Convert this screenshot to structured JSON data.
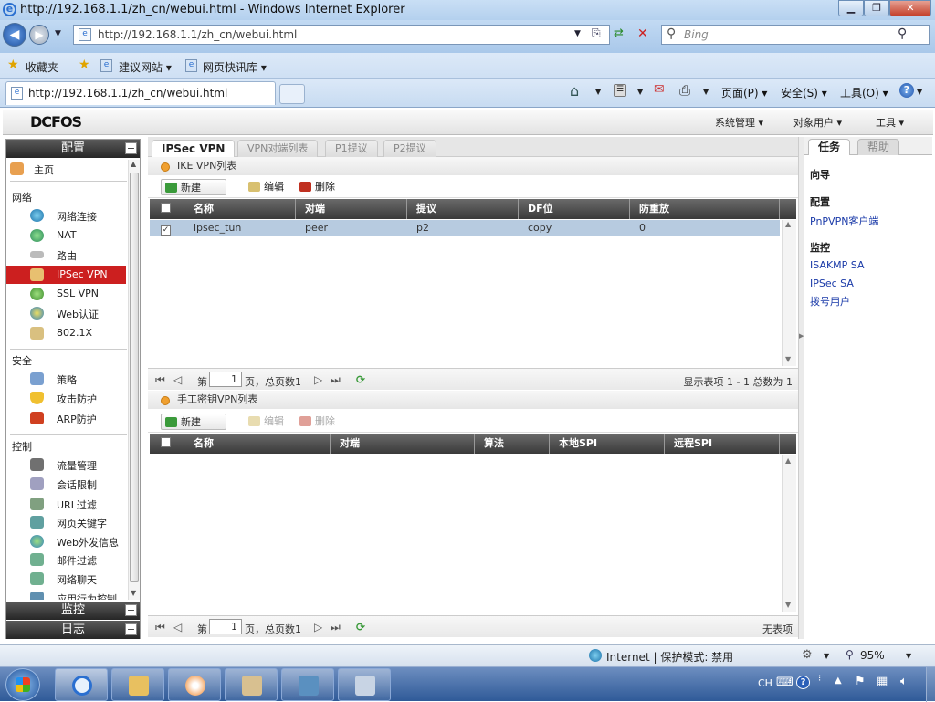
{
  "browser": {
    "window_title": "http://192.168.1.1/zh_cn/webui.html - Windows Internet Explorer",
    "address": "http://192.168.1.1/zh_cn/webui.html",
    "search_placeholder": "Bing",
    "favorites_label": "收藏夹",
    "fav_links": [
      "建议网站 ▾",
      "网页快讯库 ▾"
    ],
    "tab_title": "http://192.168.1.1/zh_cn/webui.html",
    "commands": [
      "页面(P) ▾",
      "安全(S) ▾",
      "工具(O) ▾"
    ]
  },
  "app": {
    "logo": "DCFOS",
    "top_menu": [
      "系统管理 ▾",
      "对象用户 ▾",
      "工具 ▾"
    ]
  },
  "sidebar": {
    "config_header": "配置",
    "monitor_header": "监控",
    "log_header": "日志",
    "home": "主页",
    "groups": {
      "network": "网络",
      "security": "安全",
      "control": "控制"
    },
    "network_items": [
      "网络连接",
      "NAT",
      "路由",
      "IPSec VPN",
      "SSL VPN",
      "Web认证",
      "802.1X"
    ],
    "security_items": [
      "策略",
      "攻击防护",
      "ARP防护"
    ],
    "control_items": [
      "流量管理",
      "会话限制",
      "URL过滤",
      "网页关键字",
      "Web外发信息",
      "邮件过滤",
      "网络聊天",
      "应用行为控制"
    ]
  },
  "main": {
    "tabs": [
      "IPSec VPN",
      "VPN对端列表",
      "P1提议",
      "P2提议"
    ],
    "ike": {
      "title": "IKE VPN列表",
      "new_label": "新建",
      "edit_label": "编辑",
      "delete_label": "删除",
      "columns": [
        "名称",
        "对端",
        "提议",
        "DF位",
        "防重放"
      ],
      "rows": [
        {
          "checked": true,
          "name": "ipsec_tun",
          "peer": "peer",
          "proposal": "p2",
          "df": "copy",
          "antireplay": "0"
        }
      ],
      "pager": {
        "page_prefix": "第",
        "page": "1",
        "page_suffix": "页，总页数1",
        "summary": "显示表项 1 - 1 总数为 1"
      }
    },
    "manual": {
      "title": "手工密钥VPN列表",
      "new_label": "新建",
      "edit_label": "编辑",
      "delete_label": "删除",
      "columns": [
        "名称",
        "对端",
        "算法",
        "本地SPI",
        "远程SPI"
      ],
      "pager": {
        "page_prefix": "第",
        "page": "1",
        "page_suffix": "页，总页数1",
        "summary": "无表项"
      }
    }
  },
  "right_panel": {
    "tabs": [
      "任务",
      "帮助"
    ],
    "guide": "向导",
    "config": "配置",
    "config_links": [
      "PnPVPN客户端"
    ],
    "monitor": "监控",
    "monitor_links": [
      "ISAKMP SA",
      "IPSec SA",
      "拨号用户"
    ]
  },
  "status_bar": {
    "zone": "Internet | 保护模式: 禁用",
    "zoom": "95%"
  },
  "taskbar": {
    "lang": "CH"
  }
}
